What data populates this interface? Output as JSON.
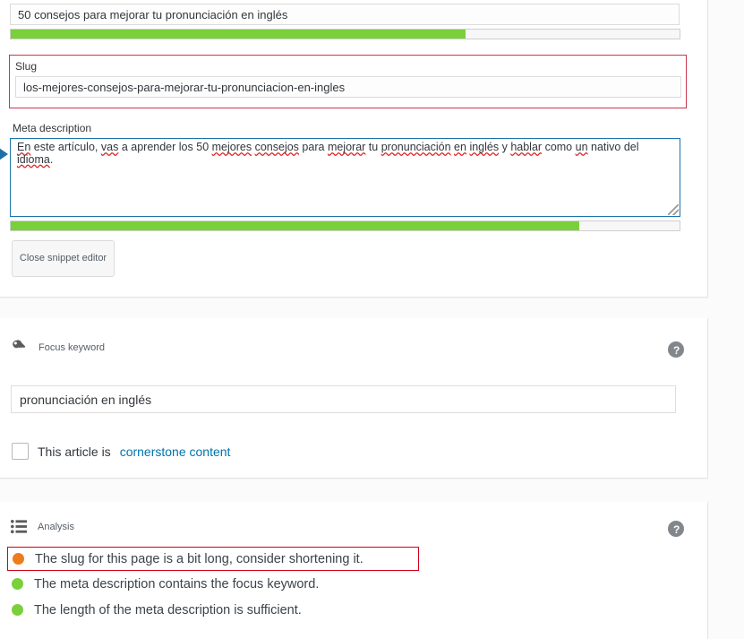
{
  "colors": {
    "progress_good": "#7ad03a",
    "bullet_orange": "#ee7c1b",
    "bullet_green": "#7ad03a",
    "slug_box_border": "#c8354f",
    "meta_box_border": "#1c72aa",
    "flag_border": "#d0021b",
    "link": "#0073aa",
    "help_bg": "#82878c"
  },
  "snippet_editor": {
    "title_value": "50 consejos para mejorar tu pronunciación en inglés",
    "title_progress_percent": 68,
    "slug_label": "Slug",
    "slug_value": "los-mejores-consejos-para-mejorar-tu-pronunciacion-en-ingles",
    "meta_label": "Meta description",
    "meta_value": "En este artículo, vas a aprender los 50 mejores consejos para mejorar tu pronunciación en inglés y hablar como un nativo del idioma.",
    "meta_progress_percent": 85,
    "close_button_label": "Close snippet editor",
    "resize_handle_name": "resize-grip",
    "left_pointer_name": "selection-pointer"
  },
  "focus_keyword": {
    "section_title": "Focus keyword",
    "section_icon": "key-icon",
    "help_icon": "help-icon",
    "help_label": "?",
    "keyword_value": "pronunciación en inglés",
    "cornerstone_prefix": "This article is",
    "cornerstone_link": "cornerstone content",
    "cornerstone_checked": false
  },
  "analysis": {
    "section_title": "Analysis",
    "section_icon": "list-icon",
    "help_icon": "help-icon",
    "help_label": "?",
    "results": [
      {
        "status": "orange",
        "text": "The slug for this page is a bit long, consider shortening it.",
        "flagged": true
      },
      {
        "status": "green",
        "text": "The meta description contains the focus keyword.",
        "flagged": false
      },
      {
        "status": "green",
        "text": "The length of the meta description is sufficient.",
        "flagged": false
      }
    ]
  }
}
